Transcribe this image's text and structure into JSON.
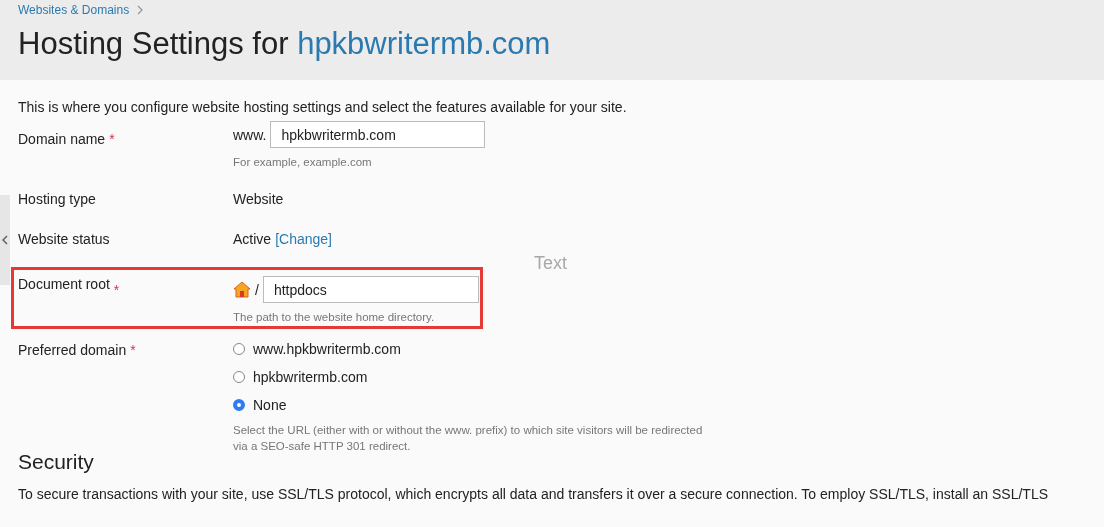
{
  "breadcrumb": [
    {
      "label": "Websites & Domains"
    }
  ],
  "title": {
    "prefix": "Hosting Settings for",
    "domain": "hpkbwritermb.com"
  },
  "intro": "This is where you configure website hosting settings and select the features available for your site.",
  "floating_label": "Text",
  "fields": [
    {
      "kind": "input",
      "label": "Domain name",
      "required_mark": "*",
      "prefix": "www.",
      "value": "hpkbwritermb.com",
      "hint": "For example, example.com"
    },
    {
      "kind": "text",
      "label": "Hosting type",
      "value": "Website"
    },
    {
      "kind": "status",
      "label": "Website status",
      "value": "Active",
      "link": "[Change]"
    },
    {
      "kind": "path",
      "label": "Document root",
      "required_mark": "*",
      "prefix": "/",
      "value": "httpdocs",
      "hint": "The path to the website home directory.",
      "highlighted": true
    },
    {
      "kind": "radio",
      "label": "Preferred domain",
      "required_mark": "*",
      "options": [
        {
          "label": "www.hpkbwritermb.com",
          "selected": false
        },
        {
          "label": "hpkbwritermb.com",
          "selected": false
        },
        {
          "label": "None",
          "selected": true
        }
      ],
      "hint": "Select the URL (either with or without the www. prefix) to which site visitors will be redirected via a SEO-safe HTTP 301 redirect."
    }
  ],
  "security": {
    "heading": "Security",
    "text": "To secure transactions with your site, use SSL/TLS protocol, which encrypts all data and transfers it over a secure connection. To employ SSL/TLS, install an SSL/TLS"
  }
}
